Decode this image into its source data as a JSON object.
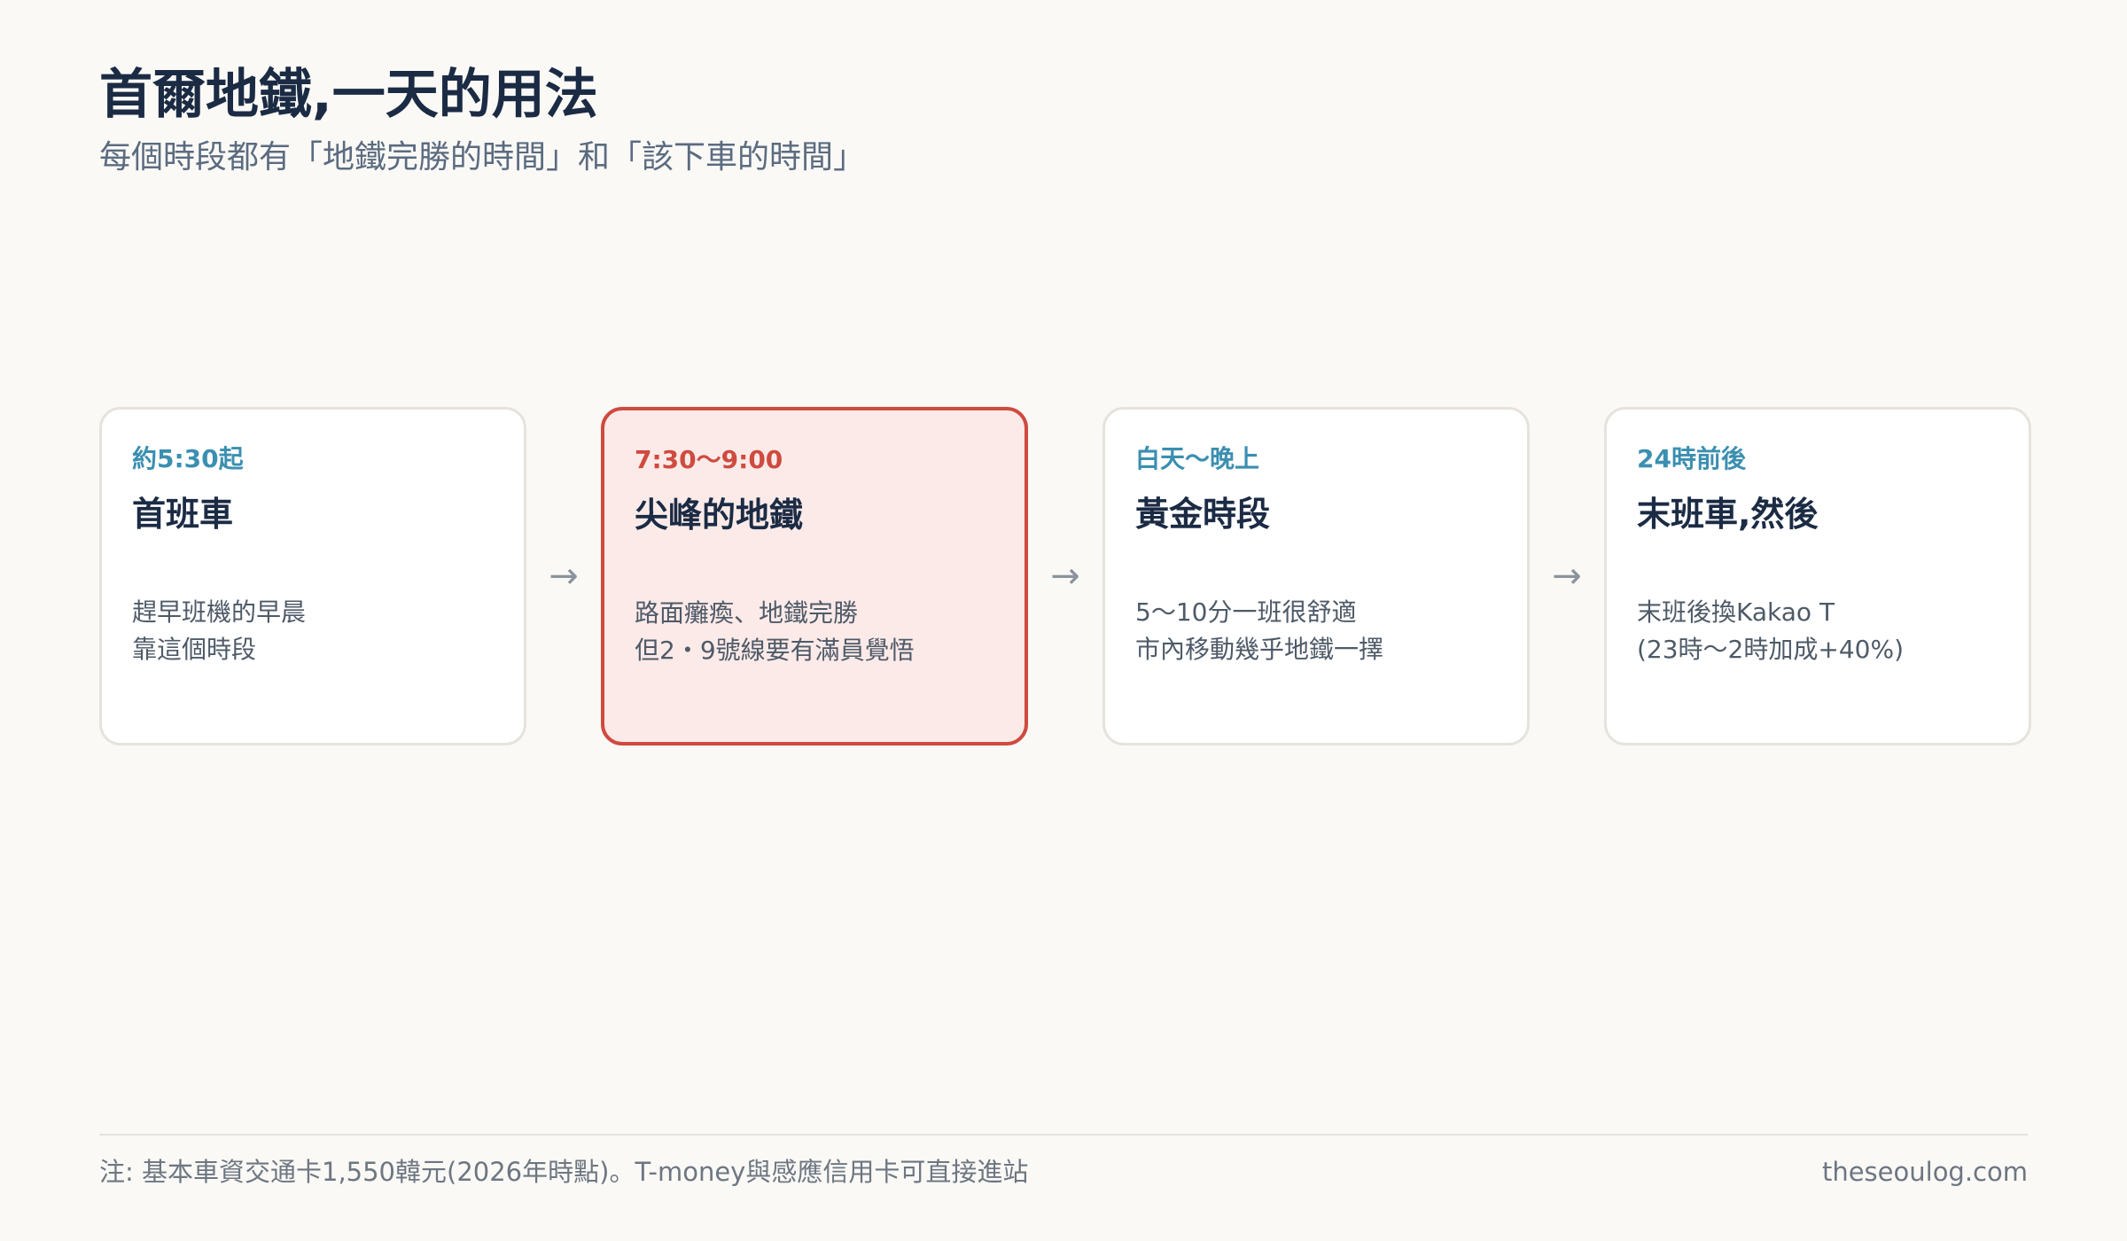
{
  "header": {
    "title": "首爾地鐵,一天的用法",
    "subtitle": "每個時段都有「地鐵完勝的時間」和「該下車的時間」"
  },
  "cards": [
    {
      "time": "約5:30起",
      "title": "首班車",
      "desc": [
        "趕早班機的早晨",
        "靠這個時段"
      ]
    },
    {
      "time": "7:30〜9:00",
      "title": "尖峰的地鐵",
      "desc": [
        "路面癱瘓、地鐵完勝",
        "但2・9號線要有滿員覺悟"
      ]
    },
    {
      "time": "白天〜晚上",
      "title": "黃金時段",
      "desc": [
        "5〜10分一班很舒適",
        "市內移動幾乎地鐵一擇"
      ]
    },
    {
      "time": "24時前後",
      "title": "末班車,然後",
      "desc": [
        "末班後換Kakao T",
        "(23時〜2時加成+40%)"
      ]
    }
  ],
  "arrow_glyph": "→",
  "footer": {
    "note": "注: 基本車資交通卡1,550韓元(2026年時點)。T-money與感應信用卡可直接進站",
    "site": "theseoulog.com"
  },
  "colors": {
    "accent_teal": "#3b8fb0",
    "highlight_red": "#cf4a3f",
    "highlight_bg": "#fceae8",
    "title_navy": "#1b2b44"
  }
}
